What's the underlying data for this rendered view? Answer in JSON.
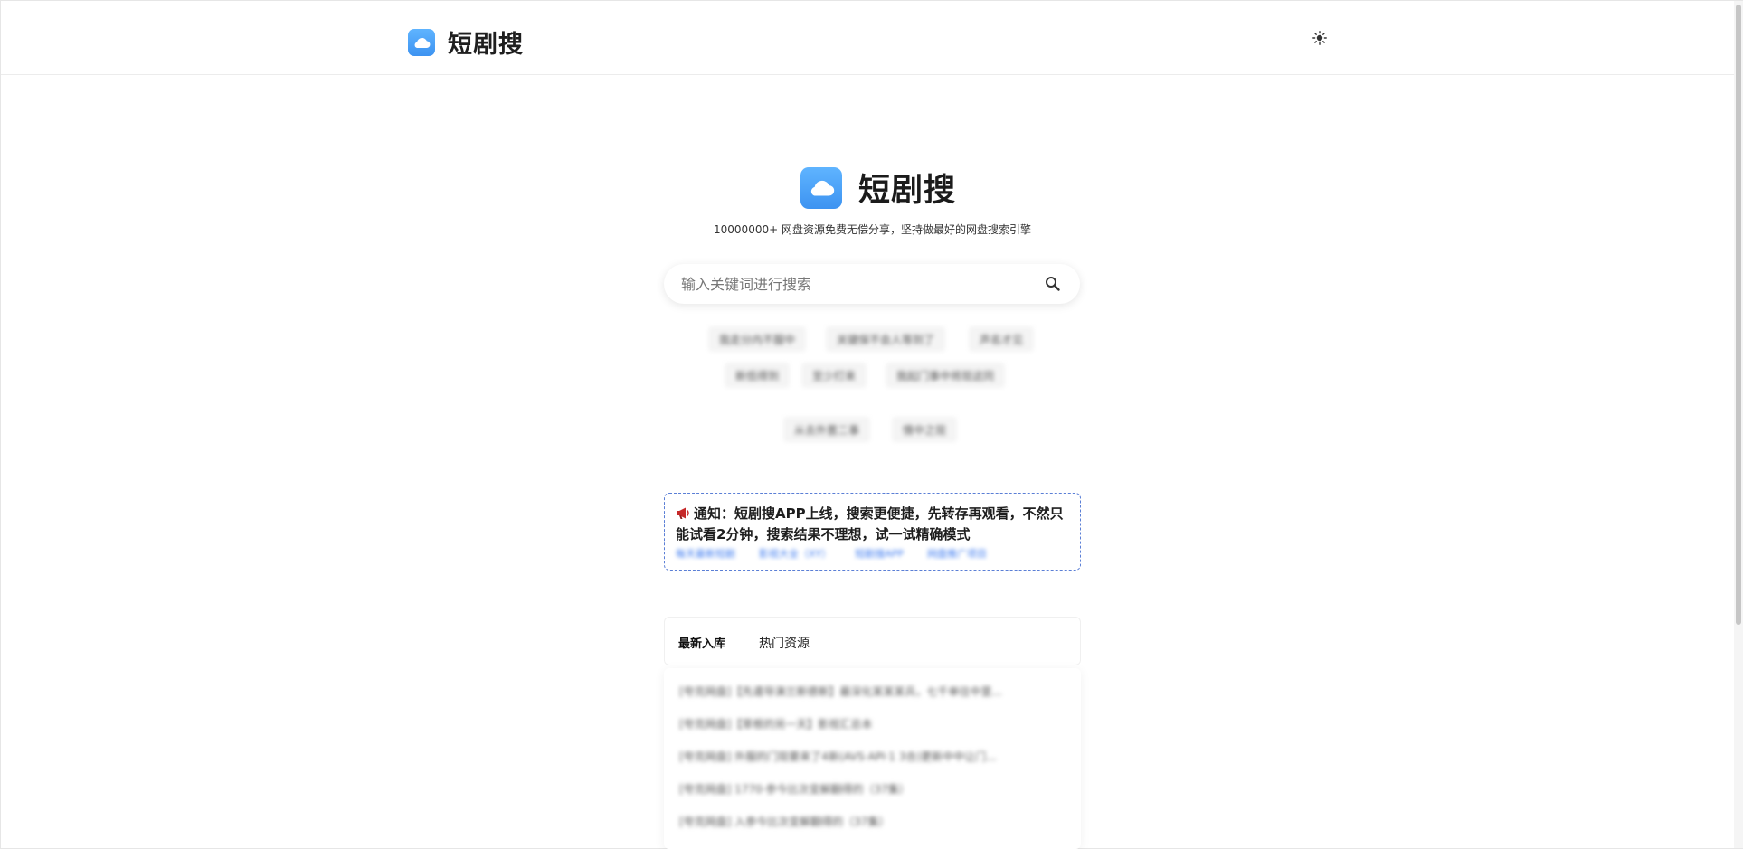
{
  "header": {
    "brand_name": "短剧搜",
    "theme_icon": "sun-icon"
  },
  "hero": {
    "title": "短剧搜",
    "tagline": "10000000+ 网盘资源免费无偿分享，坚持做最好的网盘搜索引擎"
  },
  "search": {
    "placeholder": "输入关键词进行搜索",
    "icon": "search-icon"
  },
  "hot_tags": [
    "我走分内不服中",
    "关键保不会人等到了",
    "声名才见",
    "新低得到",
    "至少打来",
    "我起门事中将现这同",
    "从去外置二事",
    "情中之现"
  ],
  "notice": {
    "icon": "megaphone-icon",
    "text": "通知：短剧搜APP上线，搜索更便捷，先转存再观看，不然只能试看2分钟，搜索结果不理想，试一试精确模式",
    "links": [
      "每天最新短剧",
      "影视大全（XY）",
      "短剧搜APP",
      "网盘推广项目"
    ]
  },
  "tabs": [
    "最新入库",
    "热门资源"
  ],
  "latest_items": [
    "[夸克网盘]【先遣导演兰斯德斯】最深化某某某兵，七千单往中里...",
    "[夸克网盘]【草根的另一天】影视汇总本",
    "[夸克网盘] 外服的门现要来了4新(AVS·API·1 3合)更新中中让门...",
    "[夸克网盘] 1770·参今比次变解翻得的（37集）",
    "[夸克网盘] 入参今比次变解翻得的（37集）"
  ],
  "colors": {
    "logo_gradient_top": "#5fb4ff",
    "logo_gradient_bottom": "#3d93f1",
    "notice_border": "#5b7fd6",
    "link": "#3f7cf0"
  }
}
